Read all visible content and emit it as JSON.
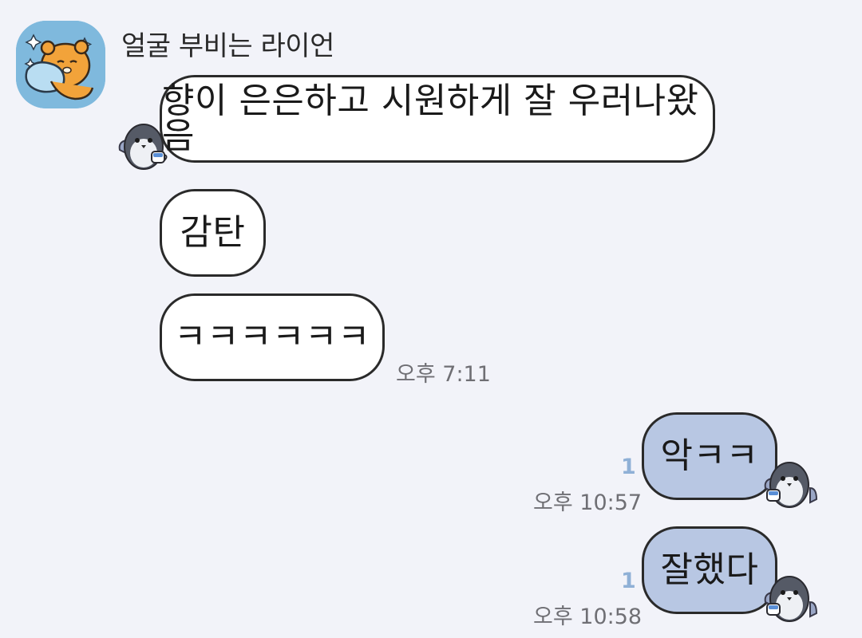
{
  "chat": {
    "sender_name": "얼굴 부비는 라이언",
    "incoming": [
      {
        "text": "향이 은은하고 시원하게 잘 우러나왔음"
      },
      {
        "text": "감탄"
      },
      {
        "text": "ㅋㅋㅋㅋㅋㅋ",
        "time": "오후 7:11"
      }
    ],
    "outgoing": [
      {
        "text": "악ㅋㅋ",
        "unread": "1",
        "time": "오후 10:57"
      },
      {
        "text": "잘했다",
        "unread": "1",
        "time": "오후 10:58"
      }
    ]
  },
  "icons": {
    "avatar": "ryan-hugging-pillow-icon",
    "sticker": "penguin-with-coffee-icon"
  },
  "colors": {
    "background": "#f2f3f9",
    "incoming_bubble": "#ffffff",
    "outgoing_bubble": "#b8c7e3",
    "unread": "#8fb0d6"
  }
}
